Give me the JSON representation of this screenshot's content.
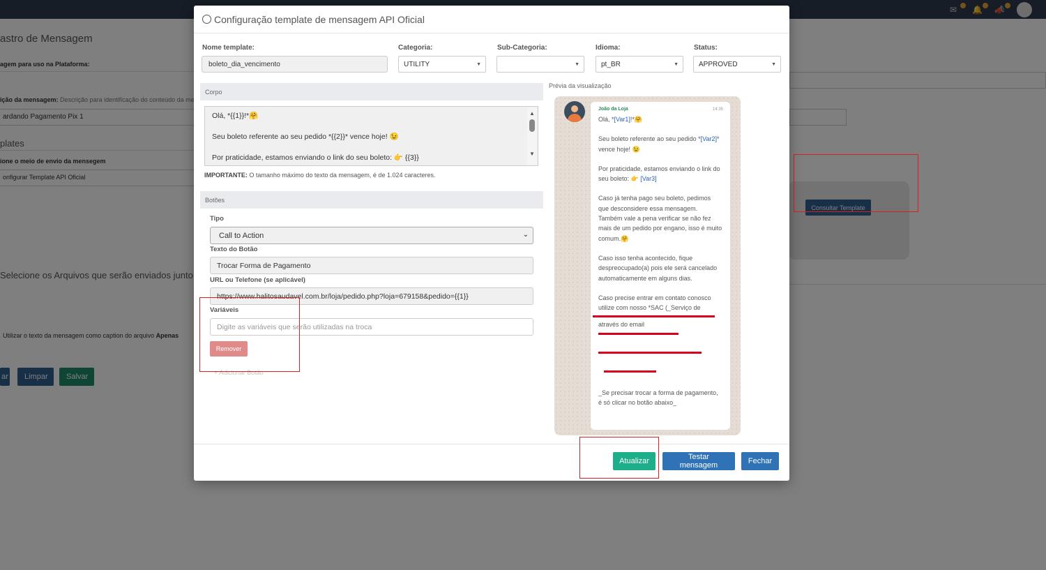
{
  "background": {
    "section_title": "astro de Mensagem",
    "label_uso": "agem para uso na Plataforma:",
    "label_descricao": "ição da mensagem:",
    "descricao_hint": "Descrição para identificação do conteúdo da mens",
    "descricao_value": "ardando Pagamento Pix 1",
    "templates_title": "plates",
    "label_meio_envio": "ione o meio de envio da mensegem",
    "meio_envio_value": "onfigurar Template API Oficial",
    "consultar_template_label": "Consultar Template",
    "arquivos_title": "Selecione os Arquivos que serão enviados junto c",
    "caption_text": "Utilizar o texto da mensagem como caption do arquivo",
    "caption_bold": "Apenas",
    "btn_prev_label": "ar",
    "btn_limpar_label": "Limpar",
    "btn_salvar_label": "Salvar"
  },
  "modal": {
    "title": "Configuração template de mensagem API Oficial",
    "fields": {
      "nome_template": {
        "label": "Nome template:",
        "value": "boleto_dia_vencimento"
      },
      "categoria": {
        "label": "Categoria:",
        "value": "UTILITY"
      },
      "sub_categoria": {
        "label": "Sub-Categoria:",
        "value": ""
      },
      "idioma": {
        "label": "Idioma:",
        "value": "pt_BR"
      },
      "status": {
        "label": "Status:",
        "value": "APPROVED"
      }
    },
    "corpo": {
      "heading": "Corpo",
      "lines": [
        "Olá, *{{1}}!*🤗",
        "Seu boleto referente ao seu pedido *{{2}}* vence hoje! 😉",
        "Por praticidade, estamos enviando o link do seu boleto: 👉 {{3}}"
      ],
      "note_bold": "IMPORTANTE:",
      "note_text": "O tamanho máximo do texto da mensagem, é de 1.024 caracteres."
    },
    "botoes": {
      "heading": "Botões",
      "tipo_label": "Tipo",
      "tipo_value": "Call to Action",
      "texto_label": "Texto do Botão",
      "texto_value": "Trocar Forma de Pagamento",
      "url_label": "URL ou Telefone (se aplicável)",
      "url_value": "https://www.halitosaudavel.com.br/loja/pedido.php?loja=679158&pedido={{1}}",
      "variaveis_label": "Variáveis",
      "variaveis_placeholder": "Digite as variáveis que serão utilizadas na troca",
      "remover_label": "Remover",
      "adicionar_label": "+ Adicionar Botão"
    },
    "preview": {
      "label": "Prévia da visualização",
      "sender": "João da Loja",
      "time": "14:35",
      "p1_a": "Olá, *",
      "p1_var": "[Var1]",
      "p1_b": "!*🤗",
      "p2_a": "Seu boleto referente ao seu pedido *",
      "p2_var": "[Var2]",
      "p2_b": "* vence hoje! 😉",
      "p3_a": "Por praticidade, estamos enviando o link do seu boleto: 👉 ",
      "p3_var": "[Var3]",
      "p4": "Caso já tenha pago seu boleto, pedimos que desconsidere essa mensagem. Também vale a pena verificar se não fez mais de um pedido por engano, isso é muito comum.🤗",
      "p5": "Caso isso tenha acontecido, fique despreocupado(a) pois ele será cancelado automaticamente em alguns dias.",
      "p6_a": "Caso precise entrar em contato conosco utilize com nosso *SAC (_Serviço de",
      "p6_b": "através do email",
      "p7": "_Se precisar trocar a forma de pagamento, é só clicar no botão abaixo_"
    },
    "footer": {
      "atualizar_label": "Atualizar",
      "testar_label": "Testar mensagem",
      "fechar_label": "Fechar"
    }
  },
  "colors": {
    "topbar": "#2d3a4d",
    "primary": "#2f72b5",
    "success": "#1fae8a",
    "danger_light": "#e08b89",
    "annotation": "#d62121"
  }
}
